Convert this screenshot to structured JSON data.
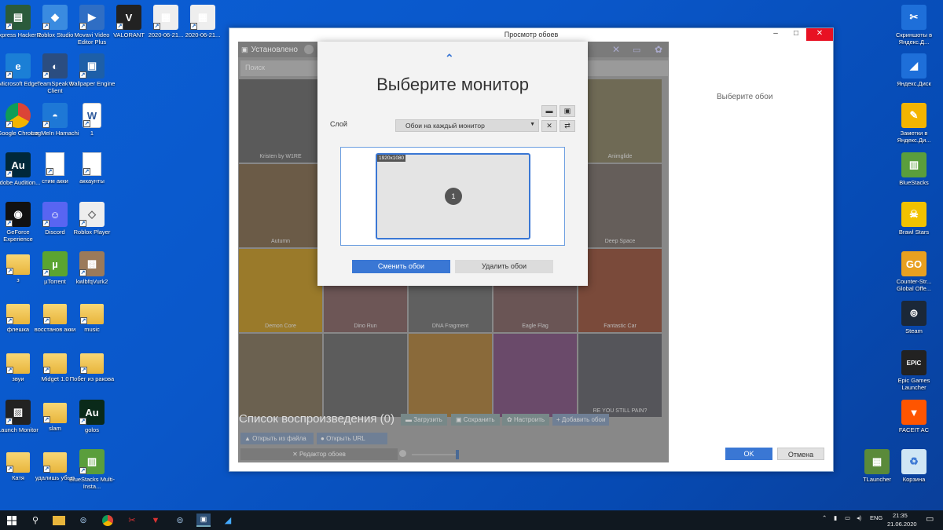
{
  "desktop_left": [
    {
      "label": "Express Hacker 2",
      "icon": "express-hacker-icon"
    },
    {
      "label": "Roblox Studio",
      "icon": "roblox-studio-icon"
    },
    {
      "label": "Movavi Video Editor Plus",
      "icon": "movavi-icon"
    },
    {
      "label": "VALORANT",
      "icon": "valorant-icon"
    },
    {
      "label": "2020-06-21...",
      "icon": "video-file-icon"
    },
    {
      "label": "2020-06-21...",
      "icon": "video-file-icon"
    },
    {
      "label": "Microsoft Edge",
      "icon": "edge-icon"
    },
    {
      "label": "TeamSpeak 3 Client",
      "icon": "teamspeak-icon"
    },
    {
      "label": "Wallpaper Engine",
      "icon": "wallpaper-engine-icon"
    },
    {
      "label": "Google Chrome",
      "icon": "chrome-icon"
    },
    {
      "label": "LogMeIn Hamachi",
      "icon": "hamachi-icon"
    },
    {
      "label": "1",
      "icon": "word-icon"
    },
    {
      "label": "Adobe Audition...",
      "icon": "audition-icon"
    },
    {
      "label": "стим акки",
      "icon": "text-file-icon"
    },
    {
      "label": "аккаунты",
      "icon": "text-file-icon"
    },
    {
      "label": "GeForce Experience",
      "icon": "geforce-icon"
    },
    {
      "label": "Discord",
      "icon": "discord-icon"
    },
    {
      "label": "Roblox Player",
      "icon": "roblox-player-icon"
    },
    {
      "label": "з",
      "icon": "folder-zip-icon"
    },
    {
      "label": "µTorrent",
      "icon": "utorrent-icon"
    },
    {
      "label": "kwlbfqVurk2",
      "icon": "image-file-icon"
    },
    {
      "label": "флешка",
      "icon": "folder-icon"
    },
    {
      "label": "восстанов акки",
      "icon": "folder-icon"
    },
    {
      "label": "music",
      "icon": "folder-icon"
    },
    {
      "label": "звуи",
      "icon": "folder-zip-icon"
    },
    {
      "label": "Midget 1.0",
      "icon": "folder-icon"
    },
    {
      "label": "Побег из ракова",
      "icon": "folder-icon"
    },
    {
      "label": "Launch Monitor",
      "icon": "launch-monitor-icon"
    },
    {
      "label": "slam",
      "icon": "folder-icon"
    },
    {
      "label": "golos",
      "icon": "audition-file-icon"
    },
    {
      "label": "Катя",
      "icon": "folder-icon"
    },
    {
      "label": "удалишь убью",
      "icon": "folder-icon"
    },
    {
      "label": "BlueStacks Multi-Insta...",
      "icon": "bluestacks-multi-icon"
    }
  ],
  "desktop_right": [
    {
      "label": "Скриншоты в Яндекс.Д...",
      "icon": "yandex-screenshot-icon"
    },
    {
      "label": "Яндекс.Диск",
      "icon": "yandex-disk-icon"
    },
    {
      "label": "Заметки в Яндекс.Ди...",
      "icon": "yandex-notes-icon"
    },
    {
      "label": "BlueStacks",
      "icon": "bluestacks-icon"
    },
    {
      "label": "Brawl Stars",
      "icon": "brawl-stars-icon"
    },
    {
      "label": "Counter-Str... Global Offe...",
      "icon": "csgo-icon"
    },
    {
      "label": "Steam",
      "icon": "steam-icon"
    },
    {
      "label": "Epic Games Launcher",
      "icon": "epic-games-icon"
    },
    {
      "label": "FACEIT AC",
      "icon": "faceit-icon"
    },
    {
      "label": "TLauncher",
      "icon": "tlauncher-icon"
    },
    {
      "label": "Корзина",
      "icon": "recycle-bin-icon"
    }
  ],
  "window": {
    "title": "Просмотр обоев",
    "minimize": "–",
    "maximize": "□",
    "close": "✕",
    "right_label": "Выберите обои",
    "ok": "OK",
    "cancel": "Отмена"
  },
  "app": {
    "tab_label": "Установлено",
    "search_placeholder": "Поиск",
    "thumbnails": [
      {
        "label": "Kristen by W1RE",
        "color": "#5a5a5a"
      },
      {
        "label": "",
        "color": "#6a6a6a"
      },
      {
        "label": "",
        "color": "#777"
      },
      {
        "label": "",
        "color": "#707070"
      },
      {
        "label": "Animglide",
        "color": "#6f6a55"
      },
      {
        "label": "Autumn",
        "color": "#6b5b47"
      },
      {
        "label": "",
        "color": "#6c6c6c"
      },
      {
        "label": "",
        "color": "#6c6c6c"
      },
      {
        "label": "",
        "color": "#6c6c6c"
      },
      {
        "label": "Deep Space",
        "color": "#655e5a"
      },
      {
        "label": "Demon Core",
        "color": "#9a7a2a"
      },
      {
        "label": "Dino Run",
        "color": "#6d5656"
      },
      {
        "label": "DNA Fragment",
        "color": "#606060"
      },
      {
        "label": "Eagle Flag",
        "color": "#6a5555"
      },
      {
        "label": "Fantastic Car",
        "color": "#7a4a3a"
      },
      {
        "label": "",
        "color": "#6b6150"
      },
      {
        "label": "",
        "color": "#5c5c5c"
      },
      {
        "label": "",
        "color": "#8a6a3a"
      },
      {
        "label": "",
        "color": "#6a4a6a"
      },
      {
        "label": "RE YOU STILL PAIN?",
        "color": "#55555a"
      }
    ],
    "playlist_title": "Список воспроизведения (0)",
    "btn_load": "Загрузить",
    "btn_save": "Сохранить",
    "btn_configure": "Настроить",
    "btn_add": "Добавить обои",
    "btn_open_file": "Открыть из файла",
    "btn_open_url": "Открыть URL",
    "btn_editor": "Редактор обоев"
  },
  "dialog": {
    "chevron": "⌃",
    "title": "Выберите монитор",
    "layer_label": "Слой",
    "layer_value": "Обои на каждый монитор",
    "monitor_res": "1920x1080",
    "monitor_num": "1",
    "btn_change": "Сменить обои",
    "btn_remove": "Удалить обои"
  },
  "tray": {
    "lang": "ENG",
    "time": "21:35",
    "date": "21.06.2020"
  }
}
